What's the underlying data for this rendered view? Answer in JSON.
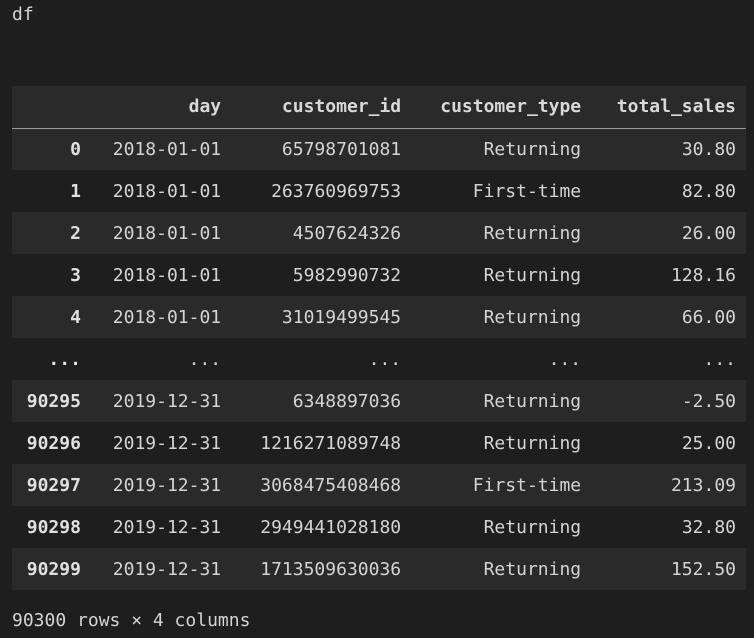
{
  "cell_input": "df",
  "table": {
    "columns": [
      "",
      "day",
      "customer_id",
      "customer_type",
      "total_sales"
    ],
    "rows": [
      [
        "0",
        "2018-01-01",
        "65798701081",
        "Returning",
        "30.80"
      ],
      [
        "1",
        "2018-01-01",
        "263760969753",
        "First-time",
        "82.80"
      ],
      [
        "2",
        "2018-01-01",
        "4507624326",
        "Returning",
        "26.00"
      ],
      [
        "3",
        "2018-01-01",
        "5982990732",
        "Returning",
        "128.16"
      ],
      [
        "4",
        "2018-01-01",
        "31019499545",
        "Returning",
        "66.00"
      ],
      [
        "...",
        "...",
        "...",
        "...",
        "..."
      ],
      [
        "90295",
        "2019-12-31",
        "6348897036",
        "Returning",
        "-2.50"
      ],
      [
        "90296",
        "2019-12-31",
        "1216271089748",
        "Returning",
        "25.00"
      ],
      [
        "90297",
        "2019-12-31",
        "3068475408468",
        "First-time",
        "213.09"
      ],
      [
        "90298",
        "2019-12-31",
        "2949441028180",
        "Returning",
        "32.80"
      ],
      [
        "90299",
        "2019-12-31",
        "1713509630036",
        "Returning",
        "152.50"
      ]
    ]
  },
  "footer": "90300 rows × 4 columns"
}
